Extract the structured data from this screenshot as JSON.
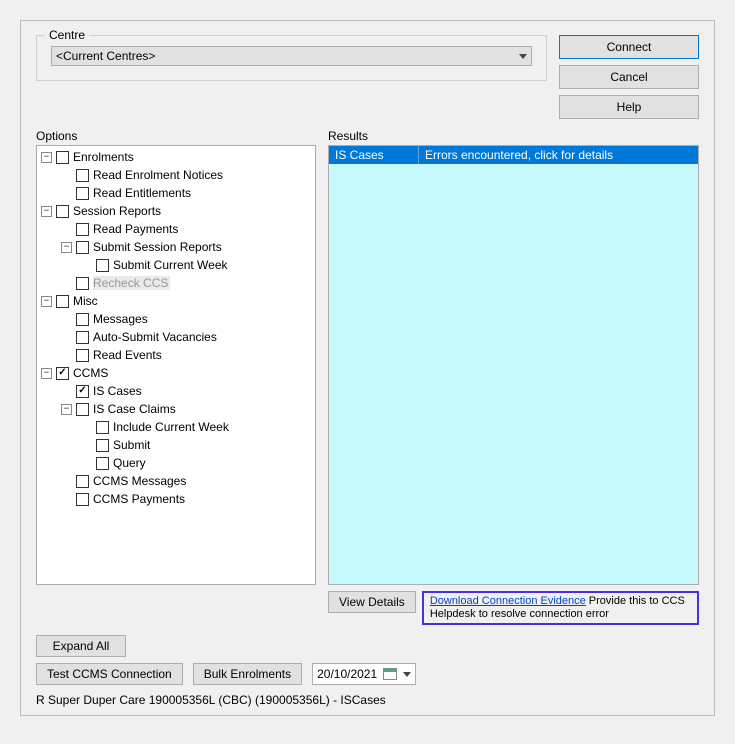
{
  "centre": {
    "legend": "Centre",
    "selected": "<Current Centres>"
  },
  "sideButtons": {
    "connect": "Connect",
    "cancel": "Cancel",
    "help": "Help"
  },
  "optionsLabel": "Options",
  "resultsLabel": "Results",
  "tree": {
    "enrolments": "Enrolments",
    "readEnrolmentNotices": "Read Enrolment Notices",
    "readEntitlements": "Read Entitlements",
    "sessionReports": "Session Reports",
    "readPayments": "Read Payments",
    "submitSessionReports": "Submit Session Reports",
    "submitCurrentWeek": "Submit Current Week",
    "recheckCCS": "Recheck CCS",
    "misc": "Misc",
    "messages": "Messages",
    "autoSubmitVacancies": "Auto-Submit Vacancies",
    "readEvents": "Read Events",
    "ccms": "CCMS",
    "isCases": "IS Cases",
    "isCaseClaims": "IS Case Claims",
    "includeCurrentWeek": "Include Current Week",
    "submit": "Submit",
    "query": "Query",
    "ccmsMessages": "CCMS Messages",
    "ccmsPayments": "CCMS Payments"
  },
  "results": {
    "colA": "IS Cases",
    "colB": "Errors encountered, click for details"
  },
  "belowResults": {
    "viewDetails": "View Details",
    "linkText": "Download Connection Evidence",
    "suffixText": " Provide this to CCS Helpdesk to resolve connection error"
  },
  "bottomButtons": {
    "expandAll": "Expand All",
    "testCCMS": "Test CCMS Connection",
    "bulkEnrolments": "Bulk Enrolments"
  },
  "date": "20/10/2021",
  "status": "R Super Duper Care 190005356L (CBC) (190005356L) - ISCases"
}
